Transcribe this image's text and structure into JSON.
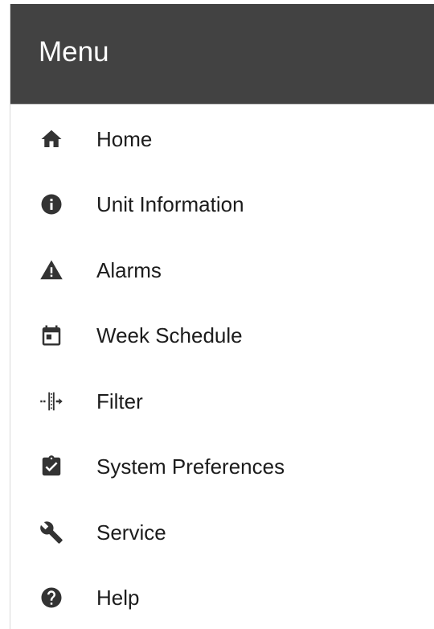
{
  "header": {
    "title": "Menu",
    "background_color": "#424242",
    "text_color": "#ffffff"
  },
  "menu": {
    "items": [
      {
        "label": "Home",
        "icon": "home-icon"
      },
      {
        "label": "Unit Information",
        "icon": "info-icon"
      },
      {
        "label": "Alarms",
        "icon": "warning-icon"
      },
      {
        "label": "Week Schedule",
        "icon": "calendar-icon"
      },
      {
        "label": "Filter",
        "icon": "filter-icon"
      },
      {
        "label": "System Preferences",
        "icon": "clipboard-check-icon"
      },
      {
        "label": "Service",
        "icon": "wrench-icon"
      },
      {
        "label": "Help",
        "icon": "help-icon"
      }
    ],
    "icon_color": "#333333",
    "text_color": "#1c1c1c"
  }
}
